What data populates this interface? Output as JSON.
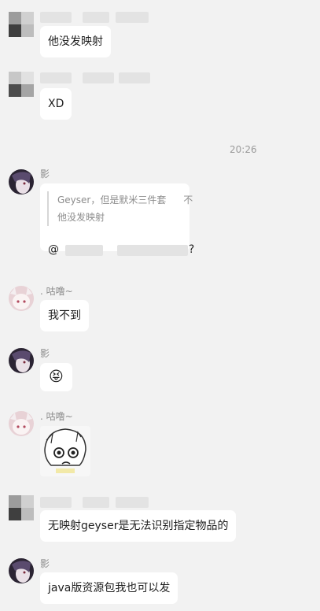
{
  "messages": [
    {
      "sender": "",
      "text": "他没发映射"
    },
    {
      "sender": "",
      "text": "XD"
    },
    {
      "time": "20:26"
    },
    {
      "sender": "影",
      "quote_line1": "Geyser，但是默米三件套",
      "quote_extra": "不",
      "quote_line2": "他没发映射",
      "mention_prefix": "@",
      "mention_suffix": "?"
    },
    {
      "sender": ". 咕噜~",
      "text": "我不到"
    },
    {
      "sender": "影",
      "emoji": "😝"
    },
    {
      "sender": ". 咕噜~",
      "sticker": "anime-sticker"
    },
    {
      "sender": "",
      "text": "无映射geyser是无法识别指定物品的"
    },
    {
      "sender": "影",
      "text": "java版资源包我也可以发"
    }
  ],
  "colors": {
    "background": "#f2f2f2",
    "bubble": "#ffffff",
    "name": "#8c8c8c"
  }
}
